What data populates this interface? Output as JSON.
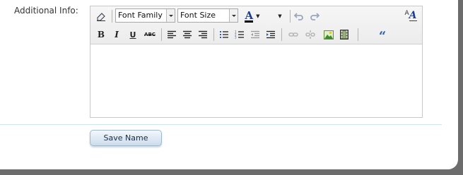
{
  "field": {
    "label": "Additional Info:"
  },
  "toolbar": {
    "font_family": "Font Family",
    "font_size": "Font Size",
    "text_color_glyph": "A",
    "bold": "B",
    "italic": "I",
    "underline": "U",
    "strikethrough": "ABC",
    "icons": [
      "eraser-icon",
      "font-color-icon",
      "undo-icon",
      "redo-icon",
      "styles-icon",
      "align-left-icon",
      "align-center-icon",
      "align-right-icon",
      "bullet-list-icon",
      "numbered-list-icon",
      "outdent-icon",
      "indent-icon",
      "link-icon",
      "unlink-icon",
      "image-icon",
      "media-icon",
      "blockquote-icon"
    ]
  },
  "save_button": {
    "label": "Save Name"
  },
  "colors": {
    "accent": "#2a5ea8",
    "divider": "#cfe6e8"
  }
}
